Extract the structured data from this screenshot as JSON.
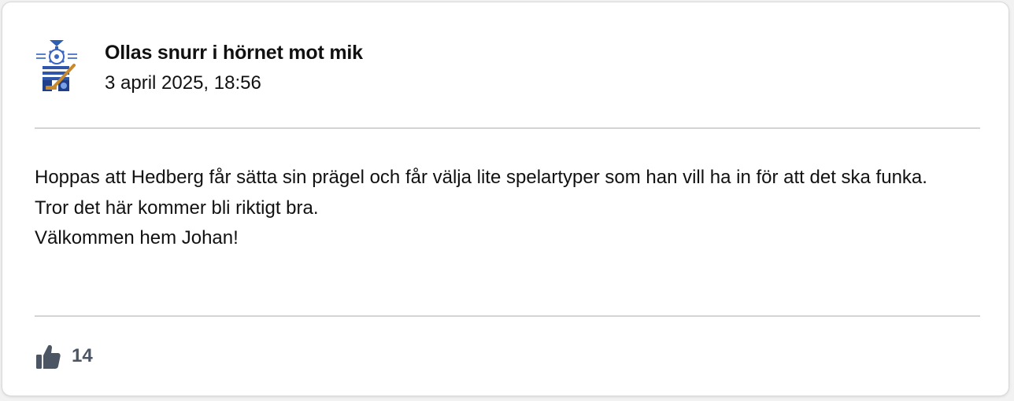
{
  "post": {
    "author": "Ollas snurr i hörnet mot mik",
    "timestamp": "3 april 2025, 18:56",
    "avatar_icon": "club-crest-icon",
    "body_lines": [
      "Hoppas att Hedberg får sätta sin prägel och får välja lite spelartyper som han vill ha in för att det ska funka.",
      "Tror det här kommer bli riktigt bra.",
      "Välkommen hem Johan!"
    ],
    "like_icon": "thumbs-up-icon",
    "like_count": "14"
  },
  "colors": {
    "card_bg": "#ffffff",
    "divider": "#d4d4d4",
    "like_icon": "#4b5563",
    "text": "#111111"
  }
}
